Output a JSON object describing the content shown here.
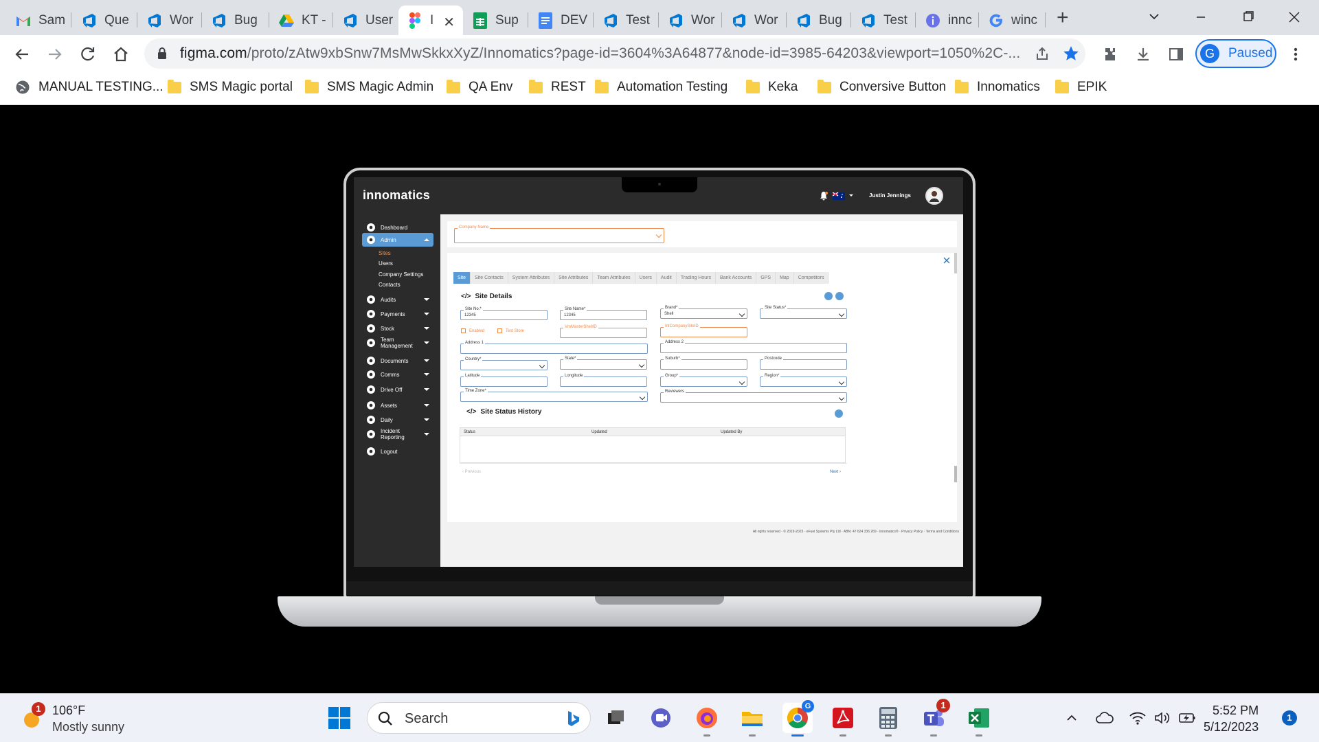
{
  "browser": {
    "tabs": [
      {
        "label": "Sam",
        "icon": "gmail-icon"
      },
      {
        "label": "Que",
        "icon": "azure-devops-icon"
      },
      {
        "label": "Wor",
        "icon": "azure-devops-icon"
      },
      {
        "label": "Bug",
        "icon": "azure-devops-icon"
      },
      {
        "label": "KT -",
        "icon": "google-drive-icon"
      },
      {
        "label": "User",
        "icon": "azure-devops-icon"
      },
      {
        "label": "I",
        "icon": "figma-icon",
        "active": true
      },
      {
        "label": "Sup",
        "icon": "google-sheets-icon"
      },
      {
        "label": "DEV",
        "icon": "google-docs-icon"
      },
      {
        "label": "Test",
        "icon": "azure-devops-icon"
      },
      {
        "label": "Wor",
        "icon": "azure-devops-icon"
      },
      {
        "label": "Wor",
        "icon": "azure-devops-icon"
      },
      {
        "label": "Bug",
        "icon": "azure-devops-icon"
      },
      {
        "label": "Test",
        "icon": "azure-devops-icon"
      },
      {
        "label": "innc",
        "icon": "info-icon"
      },
      {
        "label": "winc",
        "icon": "google-icon"
      }
    ],
    "url_main": "figma.com",
    "url_rest": "/proto/zAtw9xbSnw7MsMwSkkxXyZ/Innomatics?page-id=3604%3A64877&node-id=3985-64203&viewport=1050%2C-...",
    "profile_initial": "G",
    "profile_status": "Paused",
    "bookmarks": [
      {
        "label": "MANUAL TESTING...",
        "icon": "globe-icon"
      },
      {
        "label": "SMS Magic portal",
        "icon": "folder-icon"
      },
      {
        "label": "SMS Magic Admin",
        "icon": "folder-icon"
      },
      {
        "label": "QA Env",
        "icon": "folder-icon"
      },
      {
        "label": "REST",
        "icon": "folder-icon"
      },
      {
        "label": "Automation Testing",
        "icon": "folder-icon"
      },
      {
        "label": "Keka",
        "icon": "folder-icon"
      },
      {
        "label": "Conversive Button",
        "icon": "folder-icon"
      },
      {
        "label": "Innomatics",
        "icon": "folder-icon"
      },
      {
        "label": "EPIK",
        "icon": "folder-icon"
      }
    ]
  },
  "app": {
    "logo": "innomatics",
    "user_name": "Justin Jennings",
    "sidebar": [
      {
        "label": "Dashboard",
        "icon": "dashboard-icon"
      },
      {
        "label": "Admin",
        "icon": "user-icon",
        "selected": true
      },
      {
        "label": "Audits",
        "icon": "audit-icon"
      },
      {
        "label": "Payments",
        "icon": "payments-icon"
      },
      {
        "label": "Stock",
        "icon": "stock-icon"
      },
      {
        "label": "Team Management",
        "icon": "team-icon"
      },
      {
        "label": "Documents",
        "icon": "documents-icon"
      },
      {
        "label": "Comms",
        "icon": "comms-icon"
      },
      {
        "label": "Drive Off",
        "icon": "drive-off-icon"
      },
      {
        "label": "Assets",
        "icon": "assets-icon"
      },
      {
        "label": "Daily",
        "icon": "daily-icon"
      },
      {
        "label": "Incident Reporting",
        "icon": "incident-icon"
      },
      {
        "label": "Logout",
        "icon": "logout-icon"
      }
    ],
    "admin_sub": [
      "Sites",
      "Users",
      "Company Settings",
      "Contacts"
    ],
    "company_label": "Company Name",
    "tabs": [
      "Site",
      "Site Contacts",
      "System Attributes",
      "Site Attributes",
      "Team Attributes",
      "Users",
      "Audit",
      "Trading Hours",
      "Bank Accounts",
      "GPS",
      "Map",
      "Competitors"
    ],
    "site_details_title": "Site Details",
    "fields": {
      "site_no_label": "Site No.*",
      "site_no_value": "12345",
      "site_name_label": "Site Name*",
      "site_name_value": "12345",
      "brand_label": "Brand*",
      "brand_value": "Shell",
      "site_status_label": "Site Status*",
      "enabled_label": "Enabled",
      "test_store_label": "Test Store",
      "vm_label": "VmMasterShellID",
      "int_label": "IntCompanySiteID",
      "address1_label": "Address 1",
      "address2_label": "Address 2",
      "country_label": "Country*",
      "state_label": "State*",
      "suburb_label": "Suburb*",
      "postcode_label": "Postcode",
      "latitude_label": "Latitude",
      "longitude_label": "Longitude",
      "group_label": "Group*",
      "region_label": "Region*",
      "timezone_label": "Time Zone*",
      "reviewers_label": "Reviewers"
    },
    "history_title": "Site Status History",
    "history_cols": [
      "Status",
      "Updated",
      "Updated By"
    ],
    "prev_label": "‹ Previous",
    "next_label": "Next ›",
    "footer": "All rights reserved · © 2019-2023 · eFuel Systems Pty Ltd · ABN: 47 624 336 269 · innomatics® · Privacy Policy · Terms and Conditions"
  },
  "taskbar": {
    "temp": "106°F",
    "condition": "Mostly sunny",
    "weather_badge": "1",
    "search_label": "Search",
    "time": "5:52 PM",
    "date": "5/12/2023",
    "notif_count": "1",
    "teams_badge": "1",
    "chrome_badge": "G"
  },
  "colors": {
    "accent": "#5b9bd5",
    "orange": "#f08a4b",
    "chrome_blue": "#1a73e8",
    "sidebar": "#2b2b2b"
  }
}
